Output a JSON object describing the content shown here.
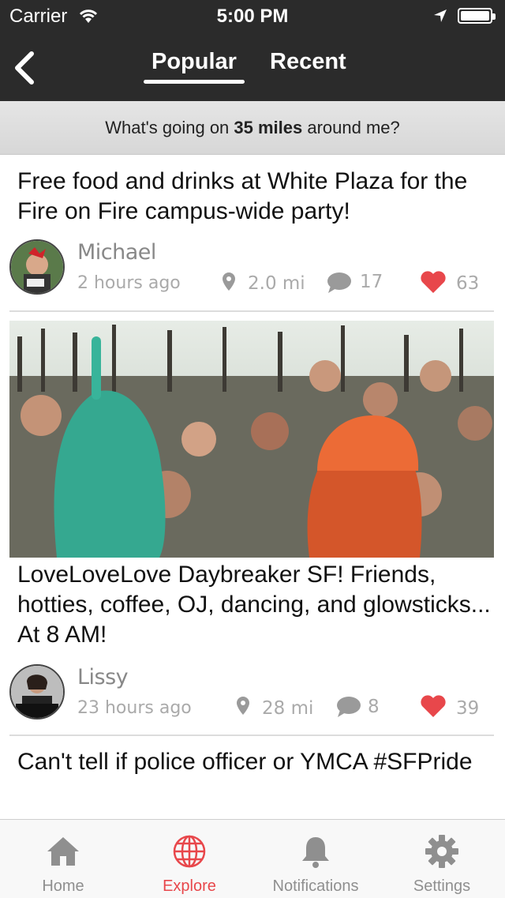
{
  "status": {
    "carrier": "Carrier",
    "time": "5:00 PM"
  },
  "nav": {
    "tabs": [
      {
        "label": "Popular",
        "selected": true
      },
      {
        "label": "Recent",
        "selected": false
      }
    ]
  },
  "banner": {
    "prefix": "What's going on ",
    "distance": "35 miles",
    "suffix": " around me?"
  },
  "posts": [
    {
      "title": "Free food and drinks at White Plaza for the Fire on Fire campus-wide party!",
      "user": "Michael",
      "time": "2 hours ago",
      "distance": "2.0 mi",
      "comments": "17",
      "likes": "63"
    },
    {
      "title": "LoveLoveLove Daybreaker SF! Friends, hotties, coffee, OJ, dancing, and glowsticks... At 8 AM!",
      "user": "Lissy",
      "time": "23 hours ago",
      "distance": "28 mi",
      "comments": "8",
      "likes": "39"
    },
    {
      "title": "Can't tell if police officer or YMCA #SFPride"
    }
  ],
  "tabbar": {
    "items": [
      {
        "label": "Home",
        "icon": "home-icon",
        "active": false
      },
      {
        "label": "Explore",
        "icon": "globe-icon",
        "active": true
      },
      {
        "label": "Notifications",
        "icon": "bell-icon",
        "active": false
      },
      {
        "label": "Settings",
        "icon": "gear-icon",
        "active": false
      }
    ]
  },
  "colors": {
    "accent": "#e8474b",
    "nav_bg": "#2b2b2b",
    "inactive": "#8f8f8f"
  }
}
